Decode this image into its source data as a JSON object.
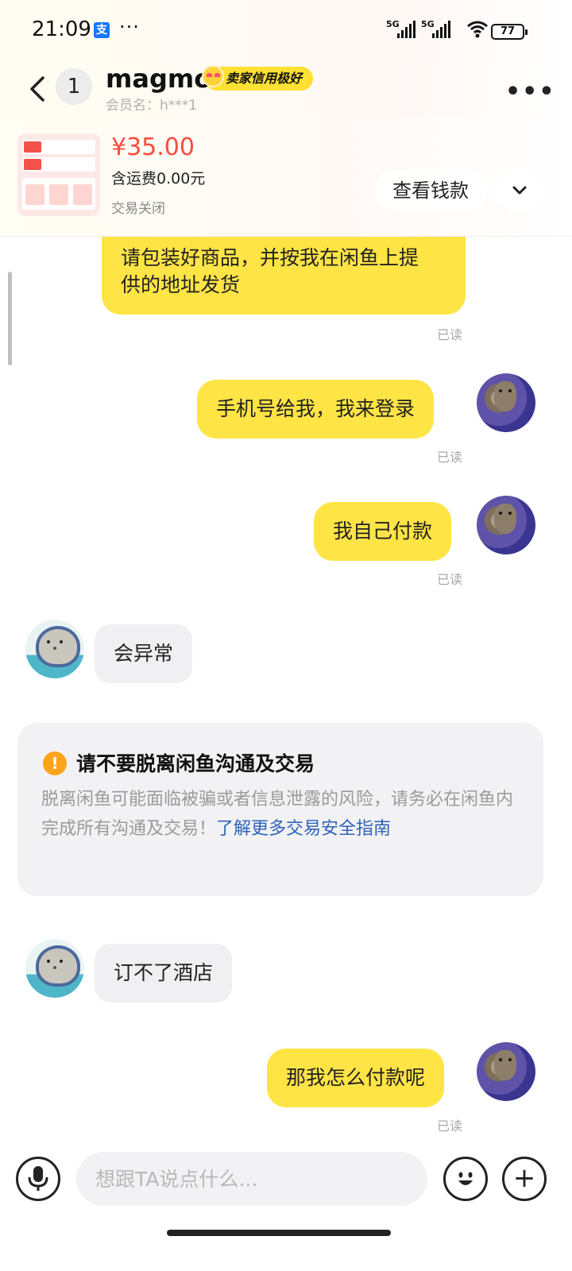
{
  "status_bar": {
    "time": "21:09",
    "app_badge": "支",
    "more": "···",
    "signal_1": "5G",
    "signal_2": "5G",
    "battery": "77"
  },
  "header": {
    "unread_count": "1",
    "contact_name": "magmo",
    "credit_badge": "卖家信用极好",
    "member_label": "会员名：h***1"
  },
  "product": {
    "price": "¥35.00",
    "shipping": "含运费0.00元",
    "deal_status": "交易关闭",
    "view_money_label": "查看钱款"
  },
  "messages": {
    "m0_text": "请包装好商品，并按我在闲鱼上提",
    "m0_text2": "供的地址发货",
    "read_label": "已读",
    "m1_text": "手机号给我，我来登录",
    "m2_text": "我自己付款",
    "m3_text": "会异常",
    "m4_text": "订不了酒店",
    "m5_text": "那我怎么付款呢"
  },
  "warning": {
    "icon": "!",
    "title": "请不要脱离闲鱼沟通及交易",
    "body": "脱离闲鱼可能面临被骗或者信息泄露的风险，请务必在闲鱼内完成所有沟通及交易！",
    "link": "了解更多交易安全指南"
  },
  "input": {
    "placeholder": "想跟TA说点什么...",
    "plus": "+"
  },
  "icons": {
    "back": "back-arrow-icon",
    "more": "more-dots-icon",
    "expand": "chevron-down-icon",
    "mic": "microphone-icon",
    "emoji": "emoji-icon",
    "plus": "plus-icon"
  },
  "colors": {
    "bubble_out": "#ffe445",
    "bubble_in": "#f0f0f2",
    "price": "#ff4a3d",
    "link": "#2e62b8",
    "badge": "#ffe033"
  }
}
